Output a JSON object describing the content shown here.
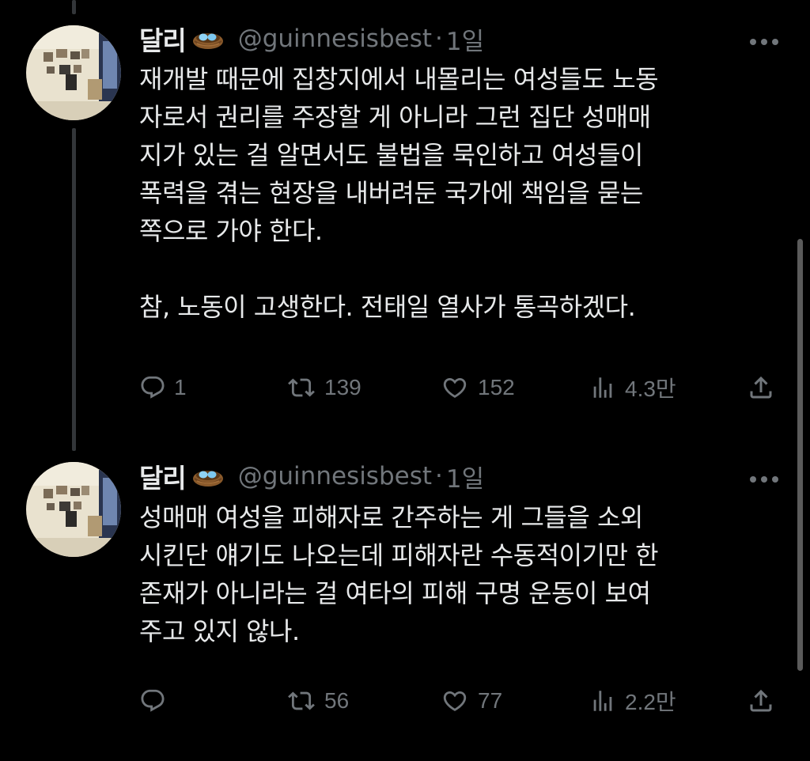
{
  "tweets": [
    {
      "author_name": "달리",
      "handle": "@guinnesisbest",
      "dot": "·",
      "time": "1일",
      "body_lines": [
        [
          "재개발 때문에 집창지에서 내몰리는 여성들도 노동",
          "자로서 권리를 주장할 게 아니라 그런 집단 성매매",
          "지가 있는 걸 알면서도 불법을 묵인하고 여성들이",
          "폭력을 겪는 현장을 내버려둔 국가에 책임을 묻는",
          "쪽으로 가야 한다."
        ],
        [
          "참, 노동이 고생한다. 전태일 열사가 통곡하겠다."
        ]
      ],
      "replies": "1",
      "retweets": "139",
      "likes": "152",
      "views": "4.3만"
    },
    {
      "author_name": "달리",
      "handle": "@guinnesisbest",
      "dot": "·",
      "time": "1일",
      "body_lines": [
        [
          "성매매 여성을 피해자로 간주하는 게 그들을 소외",
          "시킨단 얘기도 나오는데 피해자란 수동적이기만 한",
          "존재가 아니라는 걸 여타의 피해 구명 운동이 보여",
          "주고 있지 않나."
        ]
      ],
      "replies": "",
      "retweets": "56",
      "likes": "77",
      "views": "2.2만"
    }
  ],
  "icons": {
    "reply": "reply-icon",
    "retweet": "retweet-icon",
    "like": "heart-icon",
    "views": "views-icon",
    "share": "share-icon",
    "more": "more-icon",
    "badge": "nest-eggs-icon"
  },
  "colors": {
    "background": "#000000",
    "text": "#e7e9ea",
    "secondary": "#71767b",
    "thread_line": "#333639"
  }
}
